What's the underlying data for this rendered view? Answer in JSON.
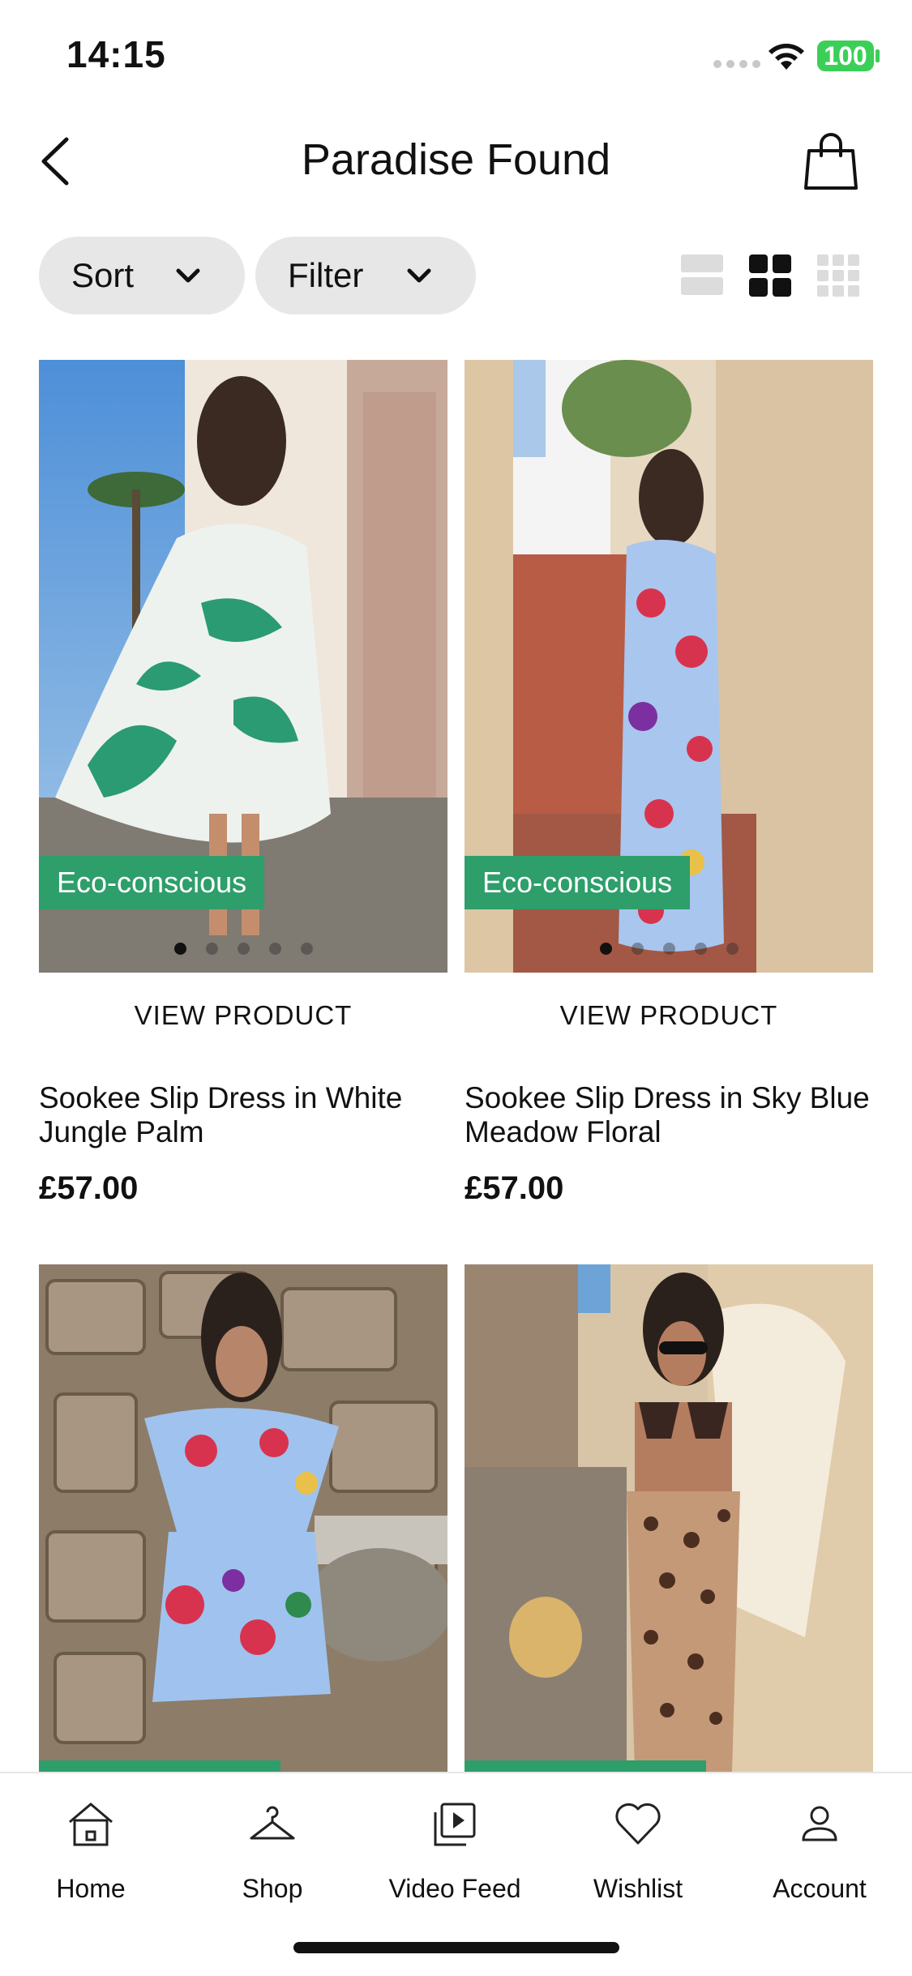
{
  "status": {
    "time": "14:15",
    "battery": "100"
  },
  "header": {
    "title": "Paradise Found"
  },
  "controls": {
    "sort_label": "Sort",
    "filter_label": "Filter"
  },
  "products": [
    {
      "badge": "Eco-conscious",
      "view_label": "VIEW PRODUCT",
      "name": "Sookee Slip Dress in White Jungle Palm",
      "price": "£57.00"
    },
    {
      "badge": "Eco-conscious",
      "view_label": "VIEW PRODUCT",
      "name": "Sookee Slip Dress in Sky Blue Meadow Floral",
      "price": "£57.00"
    }
  ],
  "tabbar": {
    "items": [
      {
        "label": "Home",
        "icon": "home-icon"
      },
      {
        "label": "Shop",
        "icon": "hanger-icon"
      },
      {
        "label": "Video Feed",
        "icon": "video-icon"
      },
      {
        "label": "Wishlist",
        "icon": "heart-icon"
      },
      {
        "label": "Account",
        "icon": "person-icon"
      }
    ]
  },
  "colors": {
    "badge": "#2e9e6b",
    "pill": "#e7e7e7",
    "battery": "#3ccf58"
  }
}
